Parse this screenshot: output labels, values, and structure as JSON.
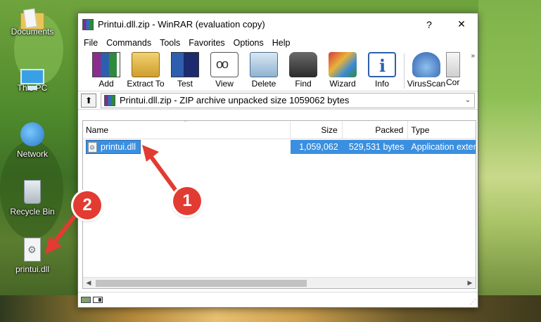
{
  "desktop": {
    "icons": [
      {
        "label": "Documents",
        "icon": "documents-folder-icon"
      },
      {
        "label": "This PC",
        "icon": "this-pc-icon"
      },
      {
        "label": "Network",
        "icon": "network-icon"
      },
      {
        "label": "Recycle Bin",
        "icon": "recycle-bin-icon"
      },
      {
        "label": "printui.dll",
        "icon": "dll-file-icon"
      }
    ]
  },
  "window": {
    "title": "Printui.dll.zip - WinRAR (evaluation copy)",
    "help_button": "?",
    "close_button": "✕",
    "menu": [
      "File",
      "Commands",
      "Tools",
      "Favorites",
      "Options",
      "Help"
    ],
    "toolbar": [
      {
        "label": "Add",
        "icon": "add-archive-icon"
      },
      {
        "label": "Extract To",
        "icon": "extract-to-icon"
      },
      {
        "label": "Test",
        "icon": "test-icon"
      },
      {
        "label": "View",
        "icon": "view-icon"
      },
      {
        "label": "Delete",
        "icon": "delete-icon"
      },
      {
        "label": "Find",
        "icon": "find-binoculars-icon"
      },
      {
        "label": "Wizard",
        "icon": "wizard-icon"
      },
      {
        "label": "Info",
        "icon": "info-icon"
      },
      {
        "label": "VirusScan",
        "icon": "virusscan-icon"
      },
      {
        "label": "Cor",
        "icon": "comment-icon"
      }
    ],
    "toolbar_overflow": "»",
    "path": {
      "up_button": "⬆",
      "text": "Printui.dll.zip - ZIP archive unpacked size 1059062 bytes",
      "dropdown": "⌄"
    },
    "columns": {
      "name": "Name",
      "size": "Size",
      "packed": "Packed",
      "type": "Type"
    },
    "sort_indicator": "^",
    "rows": [
      {
        "name": "printui.dll",
        "size": "1,059,062",
        "packed": "529,531 bytes",
        "type": "Application extension"
      }
    ],
    "scroll": {
      "left": "◀",
      "right": "▶"
    },
    "status": {
      "grip": "⋰"
    }
  },
  "annotations": [
    {
      "label": "1",
      "color": "#e23b32"
    },
    {
      "label": "2",
      "color": "#e23b32"
    }
  ]
}
